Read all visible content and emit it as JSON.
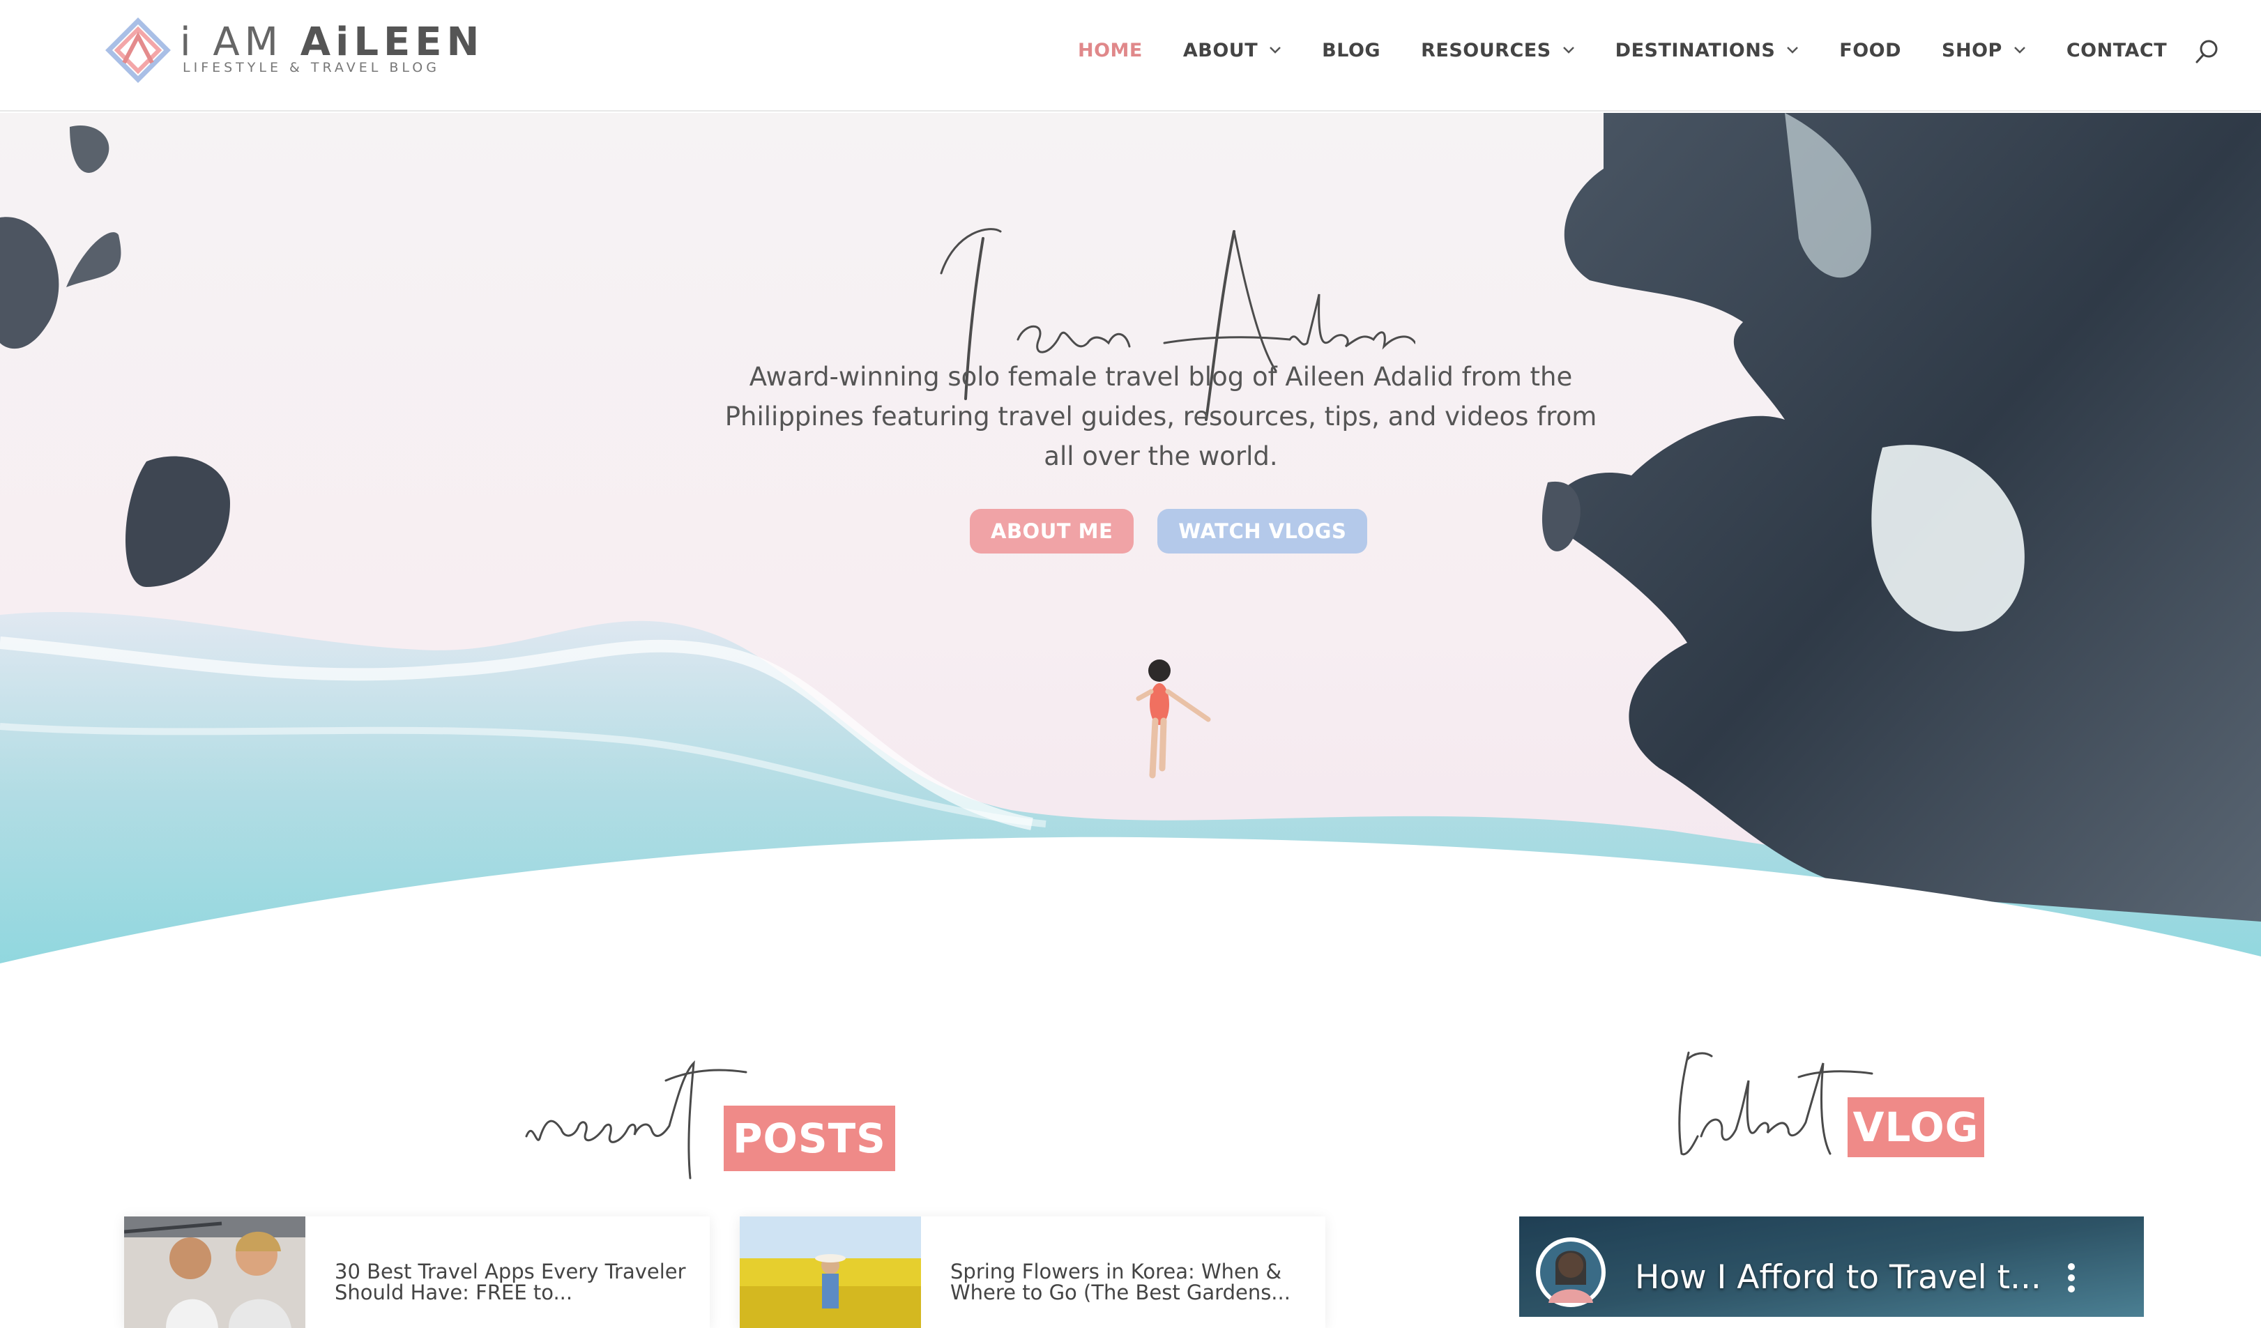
{
  "header": {
    "logo": {
      "title_thin": "i AM",
      "title_bold": "AiLEEN",
      "tagline": "LIFESTYLE & TRAVEL BLOG"
    },
    "nav": [
      {
        "label": "HOME",
        "active": true,
        "dropdown": false
      },
      {
        "label": "ABOUT",
        "active": false,
        "dropdown": true
      },
      {
        "label": "BLOG",
        "active": false,
        "dropdown": false
      },
      {
        "label": "RESOURCES",
        "active": false,
        "dropdown": true
      },
      {
        "label": "DESTINATIONS",
        "active": false,
        "dropdown": true
      },
      {
        "label": "FOOD",
        "active": false,
        "dropdown": false
      },
      {
        "label": "SHOP",
        "active": false,
        "dropdown": true
      },
      {
        "label": "CONTACT",
        "active": false,
        "dropdown": false
      }
    ],
    "search_icon": "search-icon"
  },
  "hero": {
    "script_title": "I am Aileen",
    "subtitle": "Award-winning solo female travel blog of Aileen Adalid from the Philippines featuring travel guides, resources, tips, and videos from all over the world.",
    "buttons": {
      "about": "ABOUT ME",
      "vlogs": "WATCH VLOGS"
    }
  },
  "recent_posts": {
    "script": "recent",
    "tag": "POSTS",
    "posts": [
      {
        "title": "30 Best Travel Apps Every Traveler Should Have: FREE to..."
      },
      {
        "title": "Spring Flowers in Korea: When & Where to Go (The Best Gardens..."
      }
    ]
  },
  "latest_vlog": {
    "script": "latest",
    "tag": "VLOG",
    "video_title": "How I Afford to Travel t..."
  },
  "colors": {
    "accent": "#ef8a88",
    "nav_active": "#e0888a",
    "button_blue": "#b4c9ea",
    "button_pink": "#f0a3a6"
  }
}
